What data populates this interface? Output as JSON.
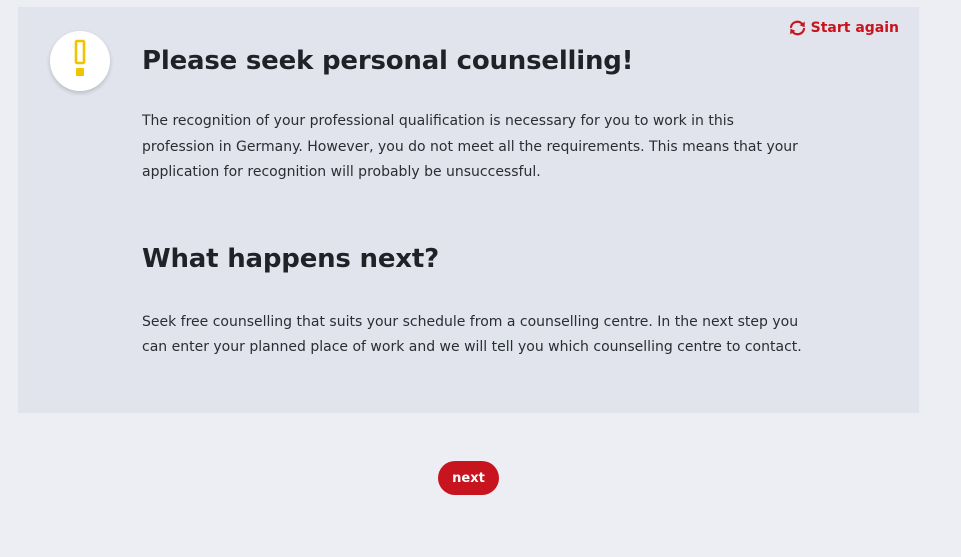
{
  "header": {
    "start_again_label": "Start again",
    "start_again_icon": "refresh-icon",
    "status_icon": "exclamation-icon"
  },
  "main": {
    "title": "Please seek personal counselling!",
    "paragraph_1": "The recognition of your professional qualification is necessary for you to work in this profession in Germany. However, you do not meet all the requirements. This means that your application for recognition will probably be unsuccessful.",
    "subtitle": "What happens next?",
    "paragraph_2": "Seek free counselling that suits your schedule from a counselling centre. In the next step you can enter your planned place of work and we will tell you which counselling centre to contact."
  },
  "footer": {
    "next_label": "next"
  },
  "colors": {
    "accent": "#c8141e",
    "warning": "#f2c400",
    "panel_bg": "#e1e4ec",
    "page_bg": "#eceef3"
  }
}
